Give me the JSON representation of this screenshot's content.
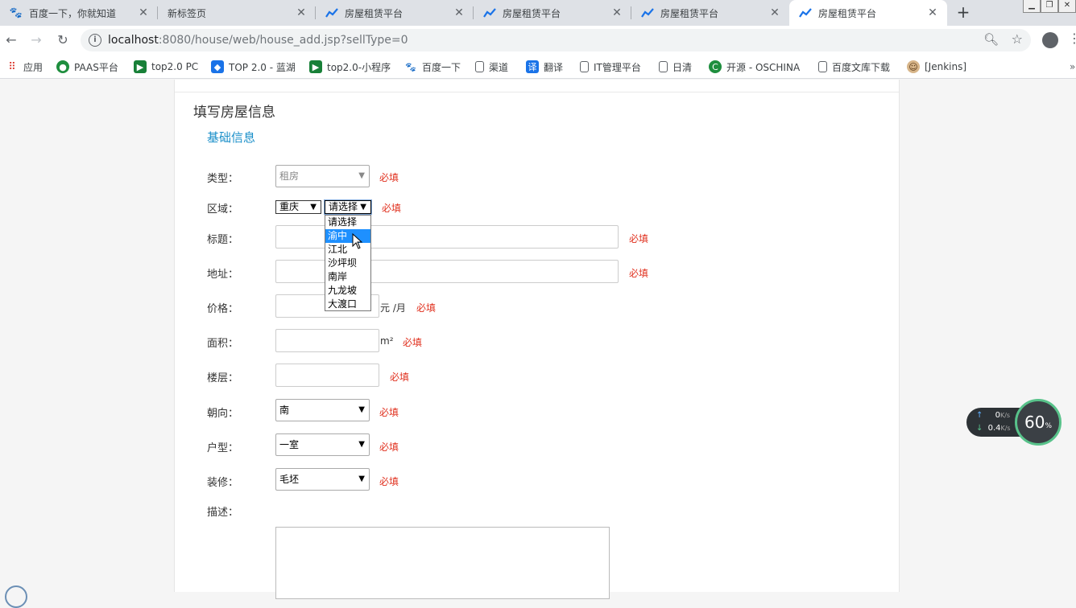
{
  "browser": {
    "tabs": [
      {
        "title": "百度一下，你就知道",
        "icon": "baidu-paw-icon",
        "active": false
      },
      {
        "title": "新标签页",
        "icon": "none",
        "active": false
      },
      {
        "title": "房屋租赁平台",
        "icon": "chart-trend-icon",
        "active": false
      },
      {
        "title": "房屋租赁平台",
        "icon": "chart-trend-icon",
        "active": false
      },
      {
        "title": "房屋租赁平台",
        "icon": "chart-trend-icon",
        "active": false
      },
      {
        "title": "房屋租赁平台",
        "icon": "chart-trend-icon",
        "active": true
      }
    ],
    "url_host": "localhost",
    "url_path": ":8080/house/web/house_add.jsp?sellType=0",
    "bookmarks": [
      {
        "label": "应用",
        "color": "#d93025"
      },
      {
        "label": "PAAS平台",
        "color": "#1e8e3e"
      },
      {
        "label": "top2.0 PC",
        "color": "#188038"
      },
      {
        "label": "TOP 2.0 - 蓝湖",
        "color": "#1a73e8"
      },
      {
        "label": "top2.0-小程序",
        "color": "#188038"
      },
      {
        "label": "百度一下",
        "color": "#2932e1"
      },
      {
        "label": "渠道",
        "color": "#9aa0a6"
      },
      {
        "label": "翻译",
        "color": "#1a73e8"
      },
      {
        "label": "IT管理平台",
        "color": "#9aa0a6"
      },
      {
        "label": "日清",
        "color": "#9aa0a6"
      },
      {
        "label": "开源 - OSCHINA",
        "color": "#1e8e3e"
      },
      {
        "label": "百度文库下载",
        "color": "#9aa0a6"
      },
      {
        "label": "[Jenkins]",
        "color": "#b06000"
      }
    ]
  },
  "form": {
    "title": "填写房屋信息",
    "section": "基础信息",
    "required_text": "必填",
    "type": {
      "label": "类型：",
      "value": "租房"
    },
    "region": {
      "label": "区域：",
      "city": "重庆",
      "district": "请选择"
    },
    "title_field": {
      "label": "标题："
    },
    "address": {
      "label": "地址："
    },
    "price": {
      "label": "价格：",
      "unit": "元 /月"
    },
    "area": {
      "label": "面积：",
      "unit": "m²"
    },
    "floor": {
      "label": "楼层："
    },
    "orientation": {
      "label": "朝向：",
      "value": "南"
    },
    "layout": {
      "label": "户型：",
      "value": "一室"
    },
    "decoration": {
      "label": "装修：",
      "value": "毛坯"
    },
    "description": {
      "label": "描述："
    }
  },
  "dropdown": {
    "options": [
      "请选择",
      "渝中",
      "江北",
      "沙坪坝",
      "南岸",
      "九龙坡",
      "大渡口"
    ],
    "highlighted_index": 1
  },
  "net_widget": {
    "up": "0",
    "up_unit": "K/s",
    "down": "0.4",
    "down_unit": "K/s",
    "percent": "60",
    "percent_unit": "%"
  }
}
